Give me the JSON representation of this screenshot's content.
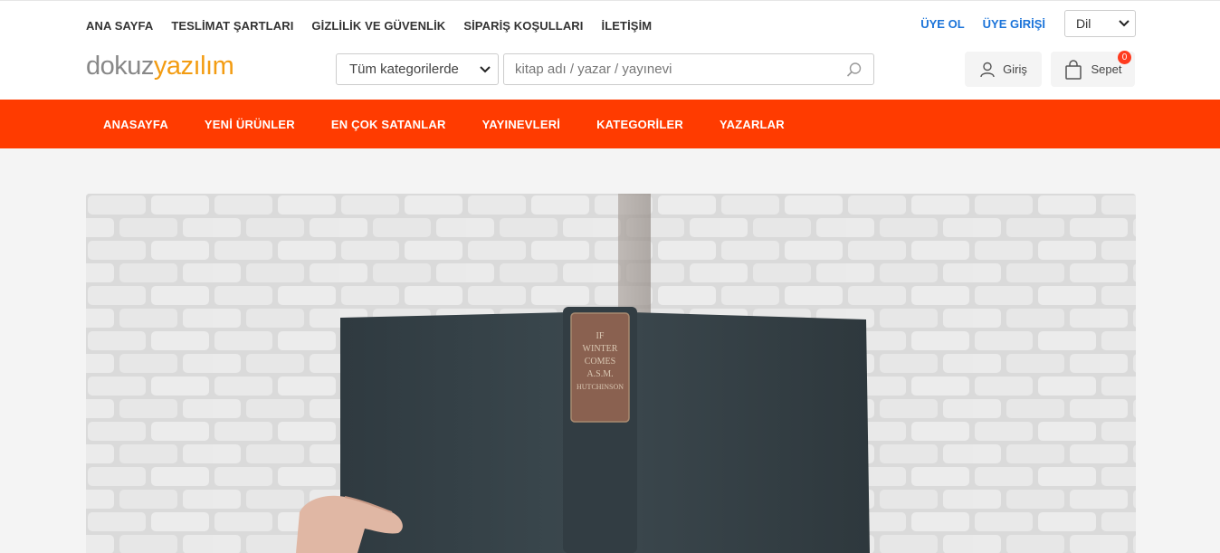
{
  "top_links": [
    "ANA SAYFA",
    "TESLİMAT ŞARTLARI",
    "GİZLİLİK VE GÜVENLİK",
    "SİPARİŞ KOŞULLARI",
    "İLETİŞİM"
  ],
  "account": {
    "register": "ÜYE OL",
    "login": "ÜYE GİRİŞİ"
  },
  "language": {
    "value": "Dil"
  },
  "logo": {
    "part1": "dokuz",
    "part2": "yazılım"
  },
  "category": {
    "value": "Tüm kategorilerde"
  },
  "search": {
    "placeholder": "kitap adı / yazar / yayınevi"
  },
  "login_button": "Giriş",
  "cart": {
    "label": "Sepet",
    "count": "0"
  },
  "main_nav": [
    "ANASAYFA",
    "YENİ ÜRÜNLER",
    "EN ÇOK SATANLAR",
    "YAYINEVLERİ",
    "KATEGORİLER",
    "YAZARLAR"
  ],
  "hero": {
    "spine_text": "IF WINTER COMES A.S.M. HUTCHINSON"
  },
  "colors": {
    "accent": "#ff3b00",
    "logo_orange": "#f39c12",
    "link_blue": "#1a73d9"
  }
}
